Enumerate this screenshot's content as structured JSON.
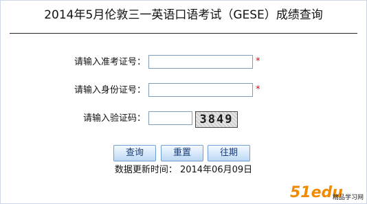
{
  "header": {
    "title": "2014年5月伦敦三一英语口语考试（GESE）成绩查询"
  },
  "form": {
    "exam_no_label": "请输入准考证号：",
    "exam_no_value": "",
    "id_no_label": "请输入身份证号：",
    "id_no_value": "",
    "captcha_label": "请输入验证码：",
    "captcha_value": "",
    "captcha_text": "3849",
    "required_mark": "*"
  },
  "buttons": {
    "query": "查询",
    "reset": "重置",
    "past": "往期"
  },
  "footer": {
    "update_text": "数据更新时间： 2014年06月09日"
  },
  "watermark": {
    "logo_text": "51edu",
    "logo_subtext": "精品学习网",
    "colors": {
      "orange": "#f28a00",
      "blue": "#2a6fbf",
      "black": "#222222"
    }
  }
}
